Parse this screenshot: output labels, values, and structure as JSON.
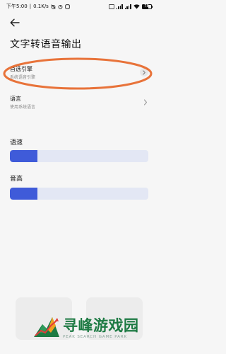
{
  "status_bar": {
    "time": "下午5:00",
    "network_speed": "0.1K/s",
    "battery_level": "78"
  },
  "header": {
    "back_icon": "arrow-left-icon",
    "title": "文字转语音输出"
  },
  "settings": {
    "engine": {
      "title": "首选引擎",
      "subtitle": "系统语音引擎"
    },
    "language": {
      "title": "语言",
      "subtitle": "使用系统语言"
    }
  },
  "sliders": {
    "speed": {
      "label": "语速",
      "fraction": 0.2
    },
    "pitch": {
      "label": "音高",
      "fraction": 0.2
    }
  },
  "watermark": {
    "main": "寻峰游戏园",
    "sub": "PEAK SEARCH GAME PARK"
  },
  "colors": {
    "accent": "#3f5bd9",
    "track": "#e3e7f4",
    "highlight": "#e8733a",
    "watermark_green": "#1d7a43"
  }
}
